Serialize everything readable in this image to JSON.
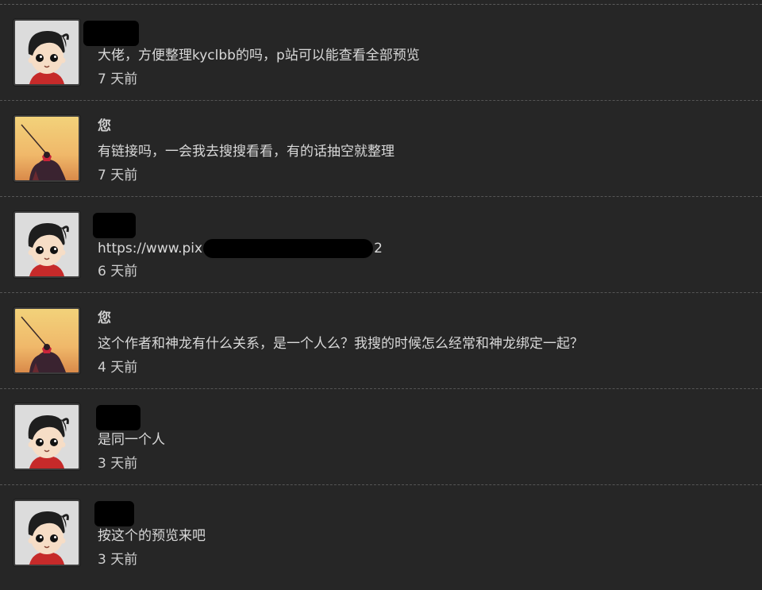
{
  "comments": [
    {
      "author": "",
      "author_redacted": true,
      "avatar": "cartoon-boy-avatar",
      "message": "大佬，方便整理kyclbb的吗，p站可以能查看全部预览",
      "time": "7 天前"
    },
    {
      "author": "您",
      "author_redacted": false,
      "avatar": "samurai-sunset-avatar",
      "message": "有链接吗，一会我去搜搜看看，有的话抽空就整理",
      "time": "7 天前"
    },
    {
      "author": "",
      "author_redacted": true,
      "avatar": "cartoon-boy-avatar",
      "message_prefix": "https://www.pix",
      "message_suffix": "2",
      "message_redacted": true,
      "time": "6 天前"
    },
    {
      "author": "您",
      "author_redacted": false,
      "avatar": "samurai-sunset-avatar",
      "message": "这个作者和神龙有什么关系，是一个人么？我搜的时候怎么经常和神龙绑定一起？",
      "time": "4 天前"
    },
    {
      "author": "",
      "author_redacted": true,
      "avatar": "cartoon-boy-avatar",
      "message": "是同一个人",
      "time": "3 天前"
    },
    {
      "author": "",
      "author_redacted": true,
      "avatar": "cartoon-boy-avatar",
      "message": "按这个的预览来吧",
      "time": "3 天前"
    }
  ],
  "colors": {
    "background": "#262626",
    "text": "#d9d9d9",
    "divider": "#555555"
  }
}
